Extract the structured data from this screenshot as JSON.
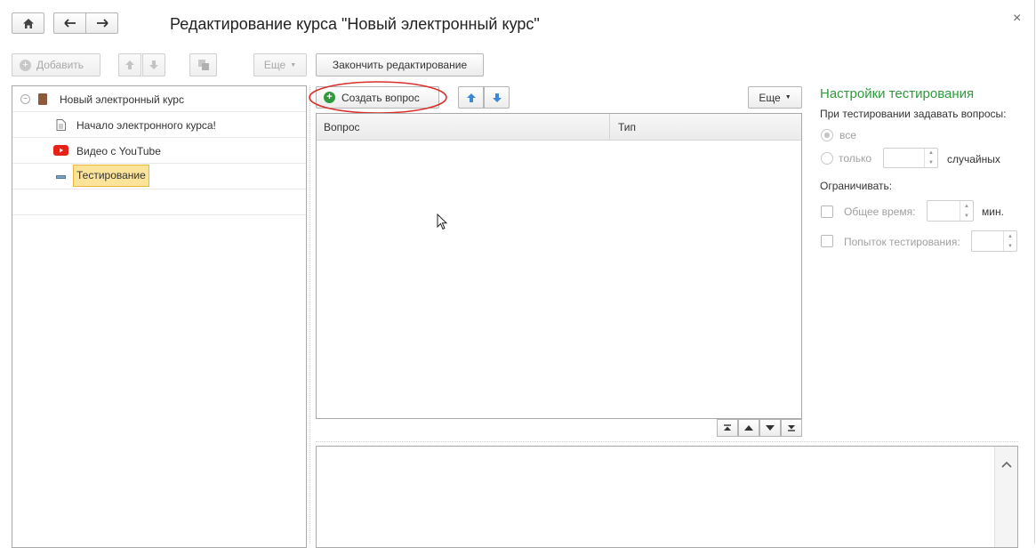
{
  "window": {
    "title": "Редактирование курса \"Новый электронный курс\"",
    "close_glyph": "×"
  },
  "toolbar": {
    "add_label": "Добавить",
    "more_label": "Еще",
    "finish_label": "Закончить редактирование"
  },
  "tree": {
    "items": [
      {
        "label": "Новый электронный курс",
        "icon": "book-icon"
      },
      {
        "label": "Начало электронного курса!",
        "icon": "document-icon"
      },
      {
        "label": "Видео с YouTube",
        "icon": "youtube-icon"
      },
      {
        "label": "Тестирование",
        "icon": "test-icon",
        "selected": true
      }
    ]
  },
  "questions": {
    "create_label": "Создать вопрос",
    "more_label": "Еще",
    "columns": [
      "Вопрос",
      "Тип"
    ],
    "rows": []
  },
  "settings": {
    "title": "Настройки тестирования",
    "ask_label": "При тестировании задавать вопросы:",
    "option_all": "все",
    "option_only": "только",
    "random_suffix": "случайных",
    "limit_label": "Ограничивать:",
    "total_time_label": "Общее время:",
    "minutes_suffix": "мин.",
    "attempts_label": "Попыток тестирования:"
  },
  "colors": {
    "accent_green": "#2e9a3c",
    "selection": "#fbe39a",
    "highlight_ellipse": "#d9302c",
    "arrow_blue": "#3a8ad9"
  }
}
